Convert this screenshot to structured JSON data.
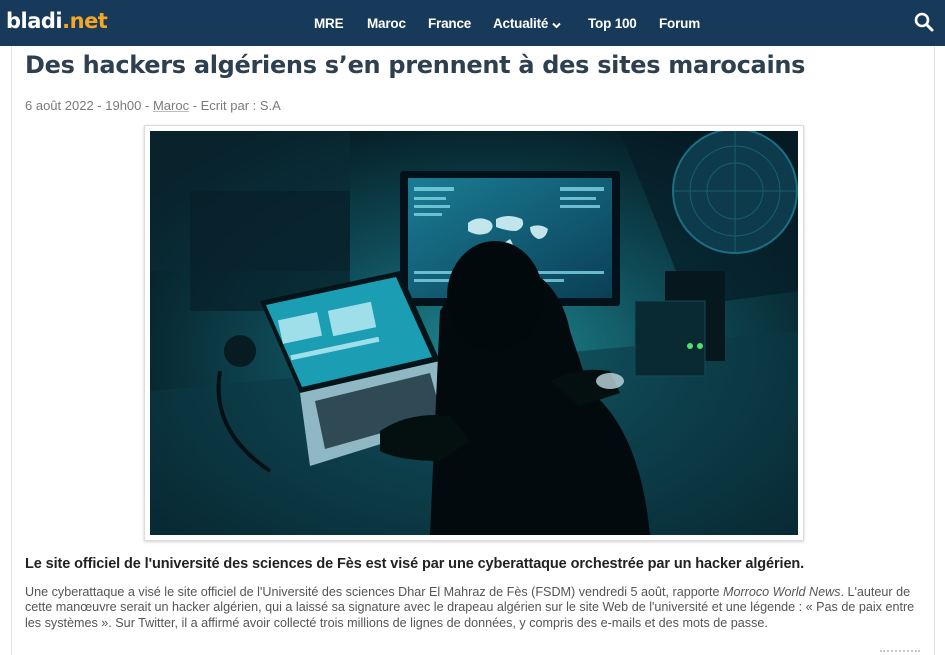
{
  "header": {
    "logo_part1": "bladi",
    "logo_part2": ".net",
    "nav": [
      {
        "label": "MRE"
      },
      {
        "label": "Maroc"
      },
      {
        "label": "France"
      },
      {
        "label": "Actualité"
      },
      {
        "label": "Top 100"
      },
      {
        "label": "Forum"
      }
    ],
    "search_icon": "search-icon",
    "dropdown_icon": "chevron-down-icon"
  },
  "article": {
    "title": "Des hackers algériens s’en prennent à des sites marocains",
    "date": "6 août 2022 - 19h00",
    "sep1": " - ",
    "category": "Maroc",
    "author_prefix": " - Ecrit par : ",
    "author": "S.A",
    "lead": "Le site officiel de l'université des sciences de Fès est visé par une cyberattaque orchestrée par un hacker algérien.",
    "body_part1": "Une cyberattaque a visé le site officiel de l'Université des sciences Dhar El Mahraz de Fès (FSDM) vendredi 5 août, rapporte ",
    "body_source": "Morroco World News",
    "body_part2": ". L'auteur de cette manœuvre serait un hacker algérien, qui a laissé sa signature avec le drapeau algérien sur le site Web de l'université et une légende : « Pas de paix entre les systèmes ». Sur Twitter, il a affirmé avoir collecté trois millions de lignes de données, y compris des e-mails et des mots de passe."
  },
  "colors": {
    "navbar": "#173a5a",
    "logo_accent": "#f5a623",
    "title": "#2e3f50"
  }
}
